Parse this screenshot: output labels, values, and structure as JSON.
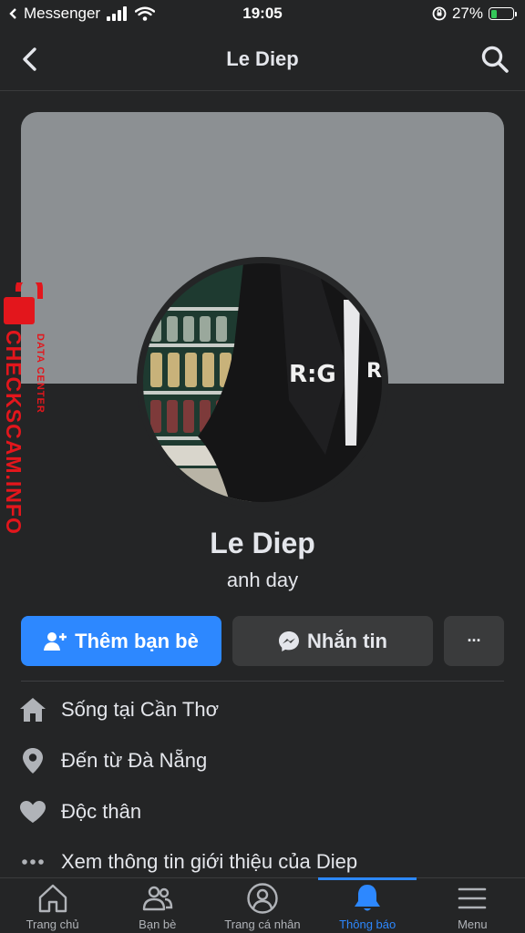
{
  "status_bar": {
    "back_app": "Messenger",
    "time": "19:05",
    "battery": "27%",
    "battery_level": 0.27,
    "battery_color": "#34c759"
  },
  "header": {
    "title": "Le Diep",
    "back_icon": "chevron-left-icon",
    "search_icon": "search-icon"
  },
  "watermark": {
    "main": "CHECKSCAM.INFO",
    "sub": "DATA CENTER",
    "icon": "lock-icon",
    "color": "#e3161c"
  },
  "profile": {
    "name": "Le Diep",
    "bio": "anh day"
  },
  "actions": {
    "add_friend": "Thêm bạn bè",
    "message": "Nhắn tin",
    "more": "···",
    "accent": "#2d88ff"
  },
  "info": [
    {
      "icon": "home-icon",
      "text": "Sống tại Cần Thơ"
    },
    {
      "icon": "location-pin-icon",
      "text": "Đến từ Đà Nẵng"
    },
    {
      "icon": "heart-icon",
      "text": "Độc thân"
    },
    {
      "icon": "more-dots-icon",
      "text": "Xem thông tin giới thiệu của Diep"
    }
  ],
  "tabs": [
    {
      "icon": "home-icon",
      "label": "Trang chủ"
    },
    {
      "icon": "friends-icon",
      "label": "Bạn bè"
    },
    {
      "icon": "profile-icon",
      "label": "Trang cá nhân"
    },
    {
      "icon": "bell-icon",
      "label": "Thông báo",
      "active": true
    },
    {
      "icon": "menu-icon",
      "label": "Menu"
    }
  ]
}
